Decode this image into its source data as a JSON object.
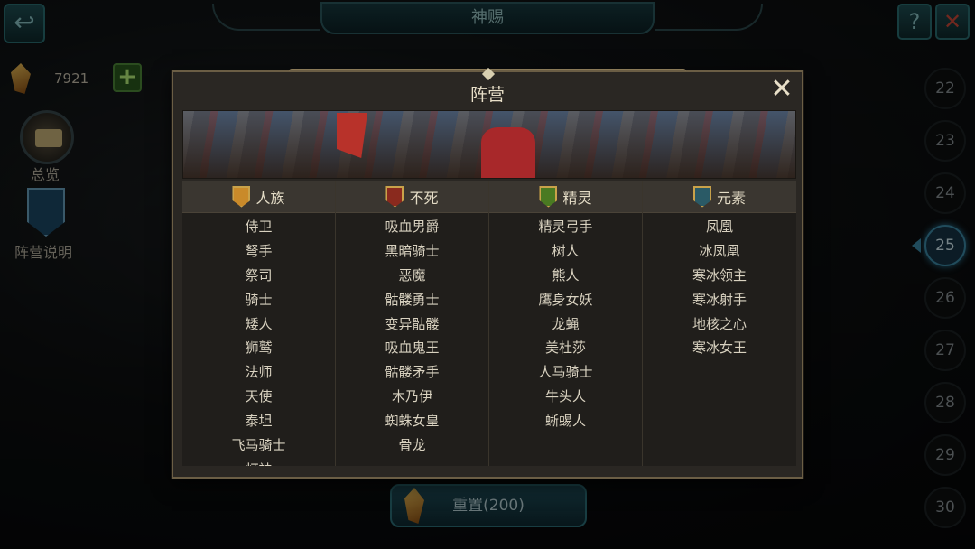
{
  "header": {
    "title": "神赐"
  },
  "left_panel": {
    "currency_amount": "7921",
    "overview_label": "总览",
    "faction_info_label": "阵营说明"
  },
  "levels": [
    "22",
    "23",
    "24",
    "25",
    "26",
    "27",
    "28",
    "29",
    "30"
  ],
  "active_level": "25",
  "reset_button_label": "重置(200)",
  "modal": {
    "title": "阵营",
    "columns": [
      {
        "name": "人族",
        "icon": "human-faction-icon",
        "units": [
          "侍卫",
          "弩手",
          "祭司",
          "骑士",
          "矮人",
          "狮鹫",
          "法师",
          "天使",
          "泰坦",
          "飞马骑士",
          "灯神"
        ]
      },
      {
        "name": "不死",
        "icon": "undead-faction-icon",
        "units": [
          "吸血男爵",
          "黑暗骑士",
          "恶魔",
          "骷髅勇士",
          "变异骷髅",
          "吸血鬼王",
          "骷髅矛手",
          "木乃伊",
          "蜘蛛女皇",
          "骨龙"
        ]
      },
      {
        "name": "精灵",
        "icon": "elf-faction-icon",
        "units": [
          "精灵弓手",
          "树人",
          "熊人",
          "鹰身女妖",
          "龙蝇",
          "美杜莎",
          "人马骑士",
          "牛头人",
          "蜥蜴人"
        ]
      },
      {
        "name": "元素",
        "icon": "element-faction-icon",
        "units": [
          "凤凰",
          "冰凤凰",
          "寒冰领主",
          "寒冰射手",
          "地核之心",
          "寒冰女王"
        ]
      }
    ]
  },
  "colors": {
    "modal_bg": "#2a2723",
    "modal_border": "#6b5e45",
    "active_level": "#3c8aa8",
    "add_button": "#2b5a1e"
  }
}
